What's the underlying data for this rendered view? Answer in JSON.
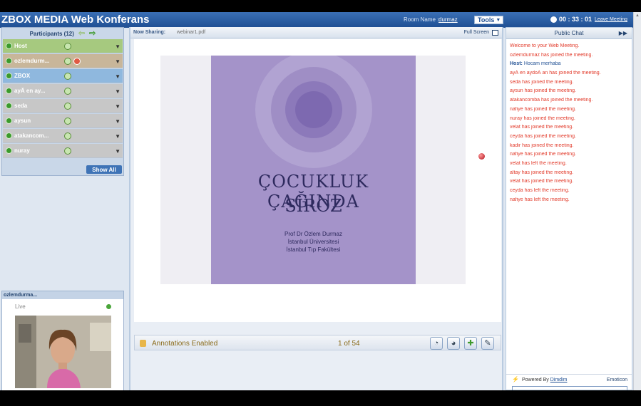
{
  "header": {
    "app_title": "ZBOX MEDIA Web Konferans",
    "room_label": "Room Name :",
    "room_name": "durmaz",
    "tools_label": "Tools",
    "timer": "00 : 33 : 01",
    "leave_label": "Leave Meeting"
  },
  "participants": {
    "title": "Participants (12)",
    "rows": [
      {
        "name": "Host",
        "role": "host",
        "muted": false
      },
      {
        "name": "ozlemdurm...",
        "role": "presenter",
        "muted": true
      },
      {
        "name": "ZBOX",
        "role": "zbox",
        "muted": false
      },
      {
        "name": "ayÃ   en ay...",
        "role": "user",
        "muted": false
      },
      {
        "name": "seda",
        "role": "user",
        "muted": false
      },
      {
        "name": "aysun",
        "role": "user",
        "muted": false
      },
      {
        "name": "atakancom...",
        "role": "user",
        "muted": false
      },
      {
        "name": "nuray",
        "role": "user",
        "muted": false
      }
    ],
    "show_all": "Show All"
  },
  "video": {
    "title": "ozlemdurma...",
    "live_label": "Live"
  },
  "sharing": {
    "label": "Now Sharing:",
    "file": "webinar1.pdf",
    "full_screen": "Full Screen",
    "slide": {
      "title": "ÇOCUKLUK ÇAĞINDA",
      "subtitle": "SİROZ",
      "lines": [
        "Prof Dr Özlem Durmaz",
        "İstanbul Üniversitesi",
        "İstanbul Tıp Fakültesi"
      ]
    },
    "annotations": "Annotations Enabled",
    "page": "1 of 54"
  },
  "chat": {
    "title": "Public Chat",
    "messages": [
      {
        "text": "Welcome to your Web Meeting.",
        "type": "system"
      },
      {
        "text": "ozlemdurmaz has joined the meeting.",
        "type": "system"
      },
      {
        "host": "Host:",
        "text": " Hocam merhaba",
        "type": "host"
      },
      {
        "text": "ayÃ   en aydoÄ   an has joined the meeting.",
        "type": "system"
      },
      {
        "text": "seda has joined the meeting.",
        "type": "system"
      },
      {
        "text": "aysun has joined the meeting.",
        "type": "system"
      },
      {
        "text": "atakancomba has joined the meeting.",
        "type": "system"
      },
      {
        "text": "nafiye has joined the meeting.",
        "type": "system"
      },
      {
        "text": "nuray has joined the meeting.",
        "type": "system"
      },
      {
        "text": "velat has joined the meeting.",
        "type": "system"
      },
      {
        "text": "ceyda has joined the meeting.",
        "type": "system"
      },
      {
        "text": "kadir has joined the meeting.",
        "type": "system"
      },
      {
        "text": "nafiye has joined the meeting.",
        "type": "system"
      },
      {
        "text": "velat has left the meeting.",
        "type": "system"
      },
      {
        "text": "altay has joined the meeting.",
        "type": "system"
      },
      {
        "text": "velat has joined the meeting.",
        "type": "system"
      },
      {
        "text": "ceyda has left the meeting.",
        "type": "system"
      },
      {
        "text": "nafiye has left the meeting.",
        "type": "system"
      }
    ],
    "powered_by": "Powered By",
    "powered_link": "Dimdim",
    "emoticon": "Emoticon"
  },
  "colors": {
    "header": "#1f4f93",
    "chat_text": "#e23a2a",
    "slide_bg": "#a493c9"
  }
}
